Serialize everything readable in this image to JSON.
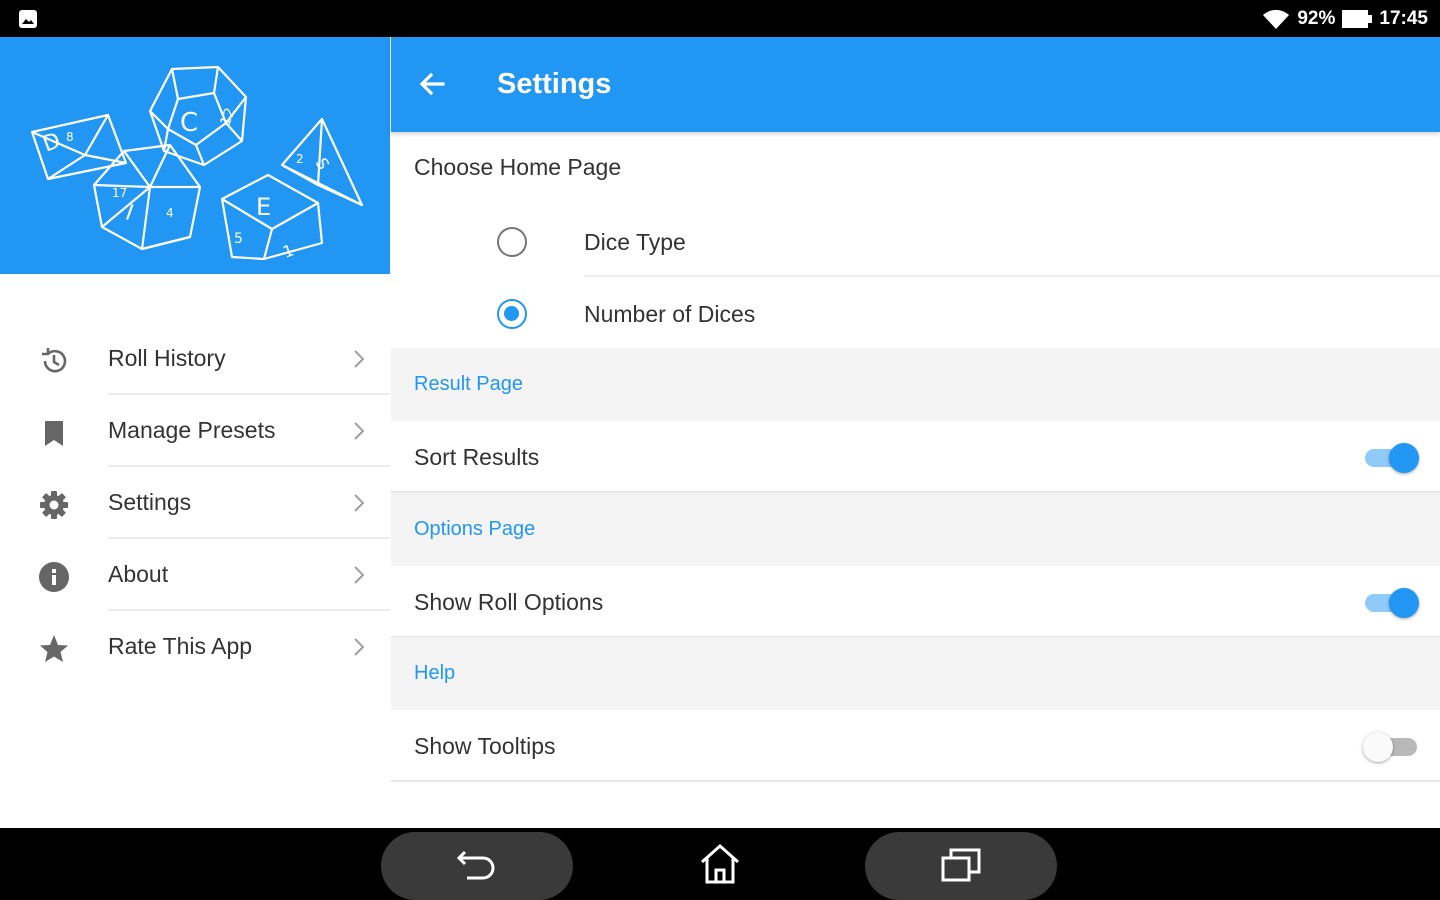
{
  "status_bar": {
    "battery": "92%",
    "time": "17:45",
    "icons": [
      "image-notification-icon",
      "wifi-icon",
      "battery-icon"
    ]
  },
  "drawer": {
    "header_logo": "dice-illustration",
    "items": [
      {
        "label": "Roll History",
        "icon": "history-icon"
      },
      {
        "label": "Manage Presets",
        "icon": "bookmark-icon"
      },
      {
        "label": "Settings",
        "icon": "gear-icon"
      },
      {
        "label": "About",
        "icon": "info-icon"
      },
      {
        "label": "Rate This App",
        "icon": "star-icon"
      }
    ]
  },
  "appbar": {
    "title": "Settings",
    "back_icon": "arrow-back-icon"
  },
  "settings": {
    "home_page": {
      "heading": "Choose Home Page",
      "options": [
        {
          "label": "Dice Type",
          "selected": false
        },
        {
          "label": "Number of Dices",
          "selected": true
        }
      ]
    },
    "sections": [
      {
        "header": "Result Page",
        "toggle": {
          "label": "Sort Results",
          "on": true
        }
      },
      {
        "header": "Options Page",
        "toggle": {
          "label": "Show Roll Options",
          "on": true
        }
      },
      {
        "header": "Help",
        "toggle": {
          "label": "Show Tooltips",
          "on": false
        }
      }
    ]
  },
  "nav_bar": {
    "buttons": [
      "back-nav-icon",
      "home-nav-icon",
      "recents-nav-icon"
    ]
  },
  "colors": {
    "primary": "#2196f3",
    "primary_light": "#90caf9",
    "section_bg": "#f4f4f4",
    "text": "#333333"
  }
}
